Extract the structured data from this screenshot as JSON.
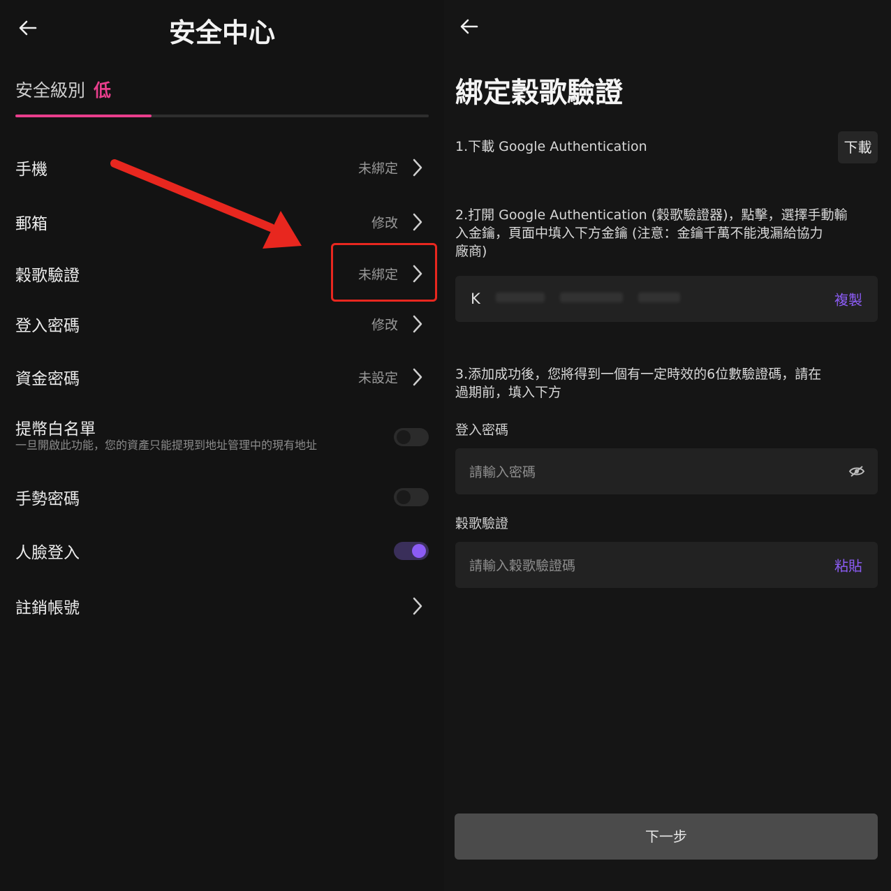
{
  "colors": {
    "accent_pink": "#e83e8c",
    "accent_purple": "#8c5cf5",
    "highlight_red": "#e8271f"
  },
  "left": {
    "title": "安全中心",
    "security_level": {
      "label": "安全級別",
      "value": "低",
      "progress_percent": 33
    },
    "items": [
      {
        "label": "手機",
        "value": "未綁定"
      },
      {
        "label": "郵箱",
        "value": "修改"
      },
      {
        "label": "穀歌驗證",
        "value": "未綁定"
      },
      {
        "label": "登入密碼",
        "value": "修改"
      },
      {
        "label": "資金密碼",
        "value": "未設定"
      }
    ],
    "whitelist": {
      "label": "提幣白名單",
      "desc": "一旦開啟此功能，您的資產只能提現到地址管理中的現有地址",
      "enabled": false
    },
    "gesture": {
      "label": "手勢密碼",
      "enabled": false
    },
    "face": {
      "label": "人臉登入",
      "enabled": true
    },
    "cancel_account": {
      "label": "註銷帳號"
    }
  },
  "right": {
    "title": "綁定穀歌驗證",
    "step1": "1.下載 Google Authentication",
    "download_label": "下載",
    "step2_line1": "2.打開 Google Authentication (穀歌驗證器)，點擊，選擇手動輸",
    "step2_line2": "入金鑰，頁面中填入下方金鑰 (注意：金鑰千萬不能洩漏給協力",
    "step2_line3": "廠商)",
    "key_prefix": "K",
    "copy_label": "複製",
    "step3_line1": "3.添加成功後，您將得到一個有一定時效的6位數驗證碼，請在",
    "step3_line2": "過期前，填入下方",
    "password_label": "登入密碼",
    "password_placeholder": "請輸入密碼",
    "google_label": "穀歌驗證",
    "google_placeholder": "請輸入穀歌驗證碼",
    "paste_label": "粘貼",
    "next_label": "下一步"
  }
}
